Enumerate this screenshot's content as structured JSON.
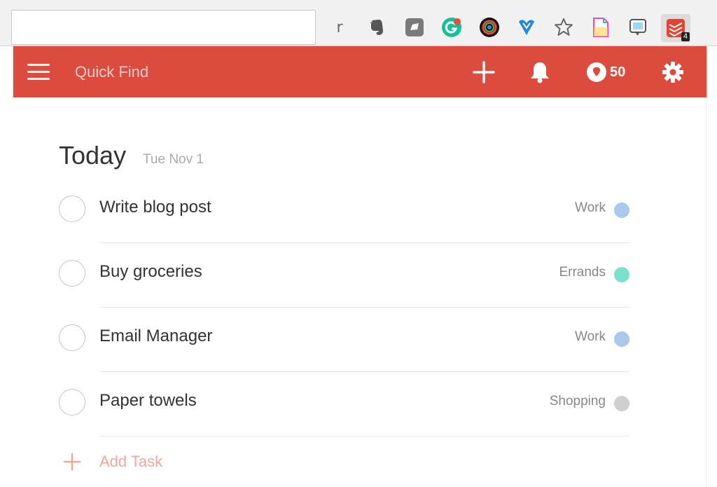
{
  "browser": {
    "extensions": [
      {
        "name": "readability",
        "glyph": "r"
      },
      {
        "name": "evernote"
      },
      {
        "name": "gray-square"
      },
      {
        "name": "grammarly"
      },
      {
        "name": "color-picker"
      },
      {
        "name": "heart-shield"
      },
      {
        "name": "bookmark-star"
      },
      {
        "name": "document"
      },
      {
        "name": "chat-note"
      },
      {
        "name": "todoist",
        "badge": "4"
      }
    ]
  },
  "header": {
    "search_placeholder": "Quick Find",
    "karma_count": "50",
    "colors": {
      "bar": "#db4c3f"
    }
  },
  "main": {
    "title": "Today",
    "date": "Tue Nov 1",
    "tasks": [
      {
        "text": "Write blog post",
        "project": "Work",
        "color": "#a9c9ec"
      },
      {
        "text": "Buy groceries",
        "project": "Errands",
        "color": "#7ae0cc"
      },
      {
        "text": "Email Manager",
        "project": "Work",
        "color": "#a9c9ec"
      },
      {
        "text": "Paper towels",
        "project": "Shopping",
        "color": "#cfcfcf"
      }
    ],
    "add_task_label": "Add Task"
  }
}
